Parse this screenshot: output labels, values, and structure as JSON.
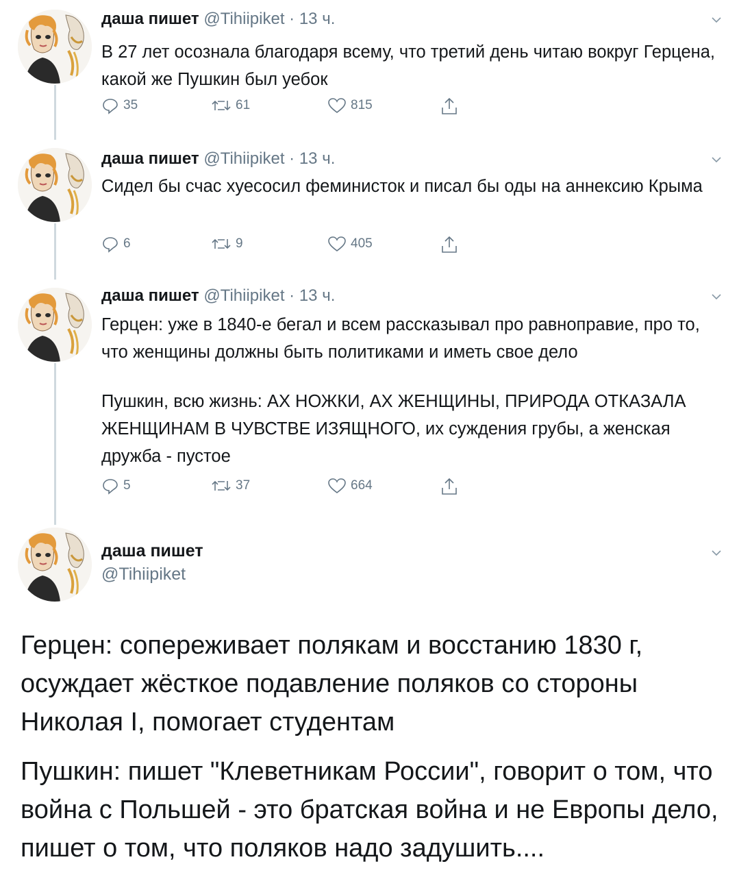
{
  "tweets": [
    {
      "name": "даша пишет",
      "handle": "@Tihiipiket",
      "dot": "·",
      "time": "13 ч.",
      "text": "В 27 лет осознала благодаря всему, что третий день читаю вокруг Герцена, какой же Пушкин был уебок",
      "replies": "35",
      "retweets": "61",
      "likes": "815"
    },
    {
      "name": "даша пишет",
      "handle": "@Tihiipiket",
      "dot": "·",
      "time": "13 ч.",
      "text": "Сидел бы счас хуесосил феминисток и писал бы оды на аннексию Крыма",
      "replies": "6",
      "retweets": "9",
      "likes": "405"
    },
    {
      "name": "даша пишет",
      "handle": "@Tihiipiket",
      "dot": "·",
      "time": "13 ч.",
      "text_p1": "Герцен: уже в 1840-е бегал и всем рассказывал про равноправие, про то, что женщины должны быть политиками и иметь свое дело",
      "text_p2": "Пушкин, всю жизнь: АХ НОЖКИ, АХ ЖЕНЩИНЫ, ПРИРОДА ОТКАЗАЛА ЖЕНЩИНАМ В ЧУВСТВЕ ИЗЯЩНОГО, их суждения грубы, а женская дружба - пустое",
      "replies": "5",
      "retweets": "37",
      "likes": "664"
    }
  ],
  "main_tweet": {
    "name": "даша пишет",
    "handle": "@Tihiipiket",
    "text_p1": "Герцен: сопереживает полякам и восстанию 1830 г, осуждает жёсткое подавление поляков со стороны Николая I, помогает студентам",
    "text_p2": "Пушкин: пишет \"Клеветникам России\", говорит о том, что война с Польшей - это братская война и не Европы дело, пишет о том, что поляков надо задушить...."
  },
  "icons": {
    "reply": "reply-icon",
    "retweet": "retweet-icon",
    "like": "like-icon",
    "share": "share-icon",
    "menu": "chevron-down-icon"
  },
  "colors": {
    "text": "#14171a",
    "secondary": "#657786",
    "thread_line": "#cfd9de"
  }
}
